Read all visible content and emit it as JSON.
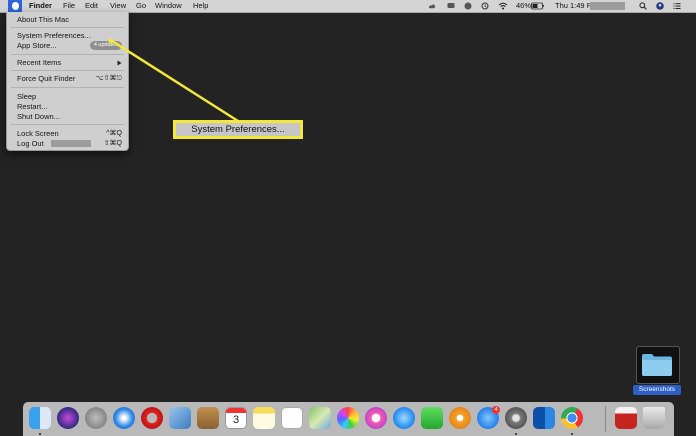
{
  "menubar": {
    "apple_icon": "apple-logo-icon",
    "items": [
      "Finder",
      "File",
      "Edit",
      "View",
      "Go",
      "Window",
      "Help"
    ],
    "status_icons": [
      "creative-cloud-icon",
      "display-icon",
      "dropbox-icon",
      "time-machine-icon",
      "wifi-icon"
    ],
    "battery": "46%",
    "clock": "Thu 1:49 PM",
    "right_icons": [
      "search-icon",
      "user-icon",
      "notification-center-icon"
    ]
  },
  "apple_menu": {
    "about": "About This Mac",
    "system_preferences": "System Preferences...",
    "app_store": "App Store...",
    "app_store_badge": "4 updates",
    "recent_items": "Recent Items",
    "force_quit": "Force Quit Finder",
    "force_quit_shortcut": "⌥⇧⌘⎋",
    "sleep": "Sleep",
    "restart": "Restart...",
    "shut_down": "Shut Down...",
    "lock_screen": "Lock Screen",
    "lock_screen_shortcut": "^⌘Q",
    "log_out": "Log Out",
    "log_out_shortcut": "⇧⌘Q"
  },
  "annotation": {
    "label": "System Preferences...",
    "color": "#f2e83a"
  },
  "desktop": {
    "folder_label": "Screenshots"
  },
  "dock": {
    "apps": [
      "finder-icon",
      "siri-icon",
      "launchpad-icon",
      "safari-icon",
      "opera-icon",
      "preview-icon",
      "notefile-icon",
      "calendar-icon",
      "notes-icon",
      "reminders-icon",
      "maps-icon",
      "photos-icon",
      "itunes-icon",
      "messages-icon",
      "facetime-icon",
      "ibooks-icon",
      "app-store-icon",
      "system-preferences-icon",
      "outlook-icon",
      "chrome-icon"
    ],
    "calendar_day": "3",
    "app_store_badge": "4",
    "trash_items": [
      "downloads-stack-icon",
      "trash-icon"
    ]
  }
}
